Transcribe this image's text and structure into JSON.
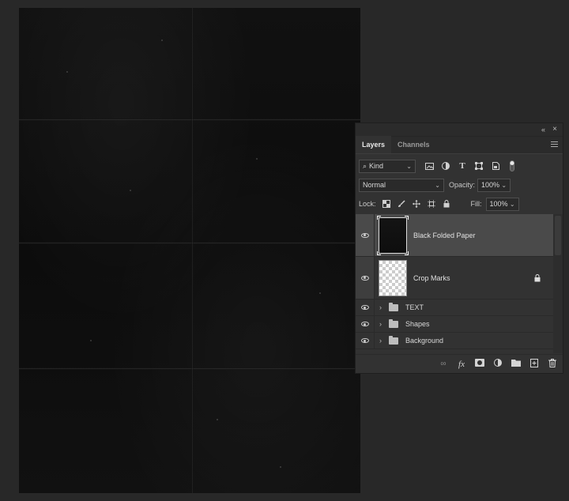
{
  "panel": {
    "tabs": [
      {
        "label": "Layers",
        "active": true
      },
      {
        "label": "Channels",
        "active": false
      }
    ],
    "collapse_icon": "double-chevron-left-icon",
    "close_icon": "close-icon",
    "filter": {
      "kind_label": "Kind",
      "filter_icons": [
        "image-filter-icon",
        "adjustment-filter-icon",
        "type-filter-icon",
        "shape-filter-icon",
        "smart-object-filter-icon",
        "filter-toggle-icon"
      ]
    },
    "blend": {
      "mode": "Normal",
      "opacity_label": "Opacity:",
      "opacity_value": "100%"
    },
    "lock": {
      "label": "Lock:",
      "fill_label": "Fill:",
      "fill_value": "100%"
    },
    "layers": [
      {
        "name": "Black Folded Paper",
        "type": "image",
        "selected": true,
        "visible": true,
        "locked": false
      },
      {
        "name": "Crop Marks",
        "type": "image",
        "selected": false,
        "visible": true,
        "locked": true
      },
      {
        "name": "TEXT",
        "type": "group",
        "visible": true
      },
      {
        "name": "Shapes",
        "type": "group",
        "visible": true
      },
      {
        "name": "Background",
        "type": "group",
        "visible": true
      }
    ],
    "bottom_icons": [
      "link-layers-icon",
      "fx-icon",
      "add-mask-icon",
      "adjustment-layer-icon",
      "new-group-icon",
      "new-layer-icon",
      "delete-icon"
    ]
  },
  "colors": {
    "app_bg": "#282828",
    "panel_bg": "#323232",
    "selected_row": "#4a4a4a"
  }
}
